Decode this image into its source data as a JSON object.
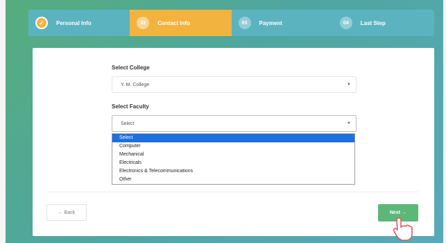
{
  "steps": [
    {
      "label": "Personal Info",
      "num": "✓",
      "state": "done"
    },
    {
      "label": "Contact Info",
      "num": "02",
      "state": "active"
    },
    {
      "label": "Payment",
      "num": "03",
      "state": "pending"
    },
    {
      "label": "Last Step",
      "num": "04",
      "state": "pending"
    }
  ],
  "college": {
    "label": "Select College",
    "value": "Y. M. College"
  },
  "faculty": {
    "label": "Select Faculty",
    "value": "Select",
    "options": [
      "Select",
      "Computer",
      "Mechanical",
      "Electricals",
      "Electronics & Telecommunications",
      "Other"
    ],
    "selected_option": "Select"
  },
  "buttons": {
    "back": "← Back",
    "next": "Next →"
  },
  "icons": {
    "check": "check-icon",
    "chevron": "chevron-down-icon",
    "cursor": "hand-pointer-icon"
  },
  "colors": {
    "active_step": "#f2b43e",
    "step_bar": "#5cb3c0",
    "next_button": "#5cb879",
    "selected_option": "#1e6fe0"
  }
}
